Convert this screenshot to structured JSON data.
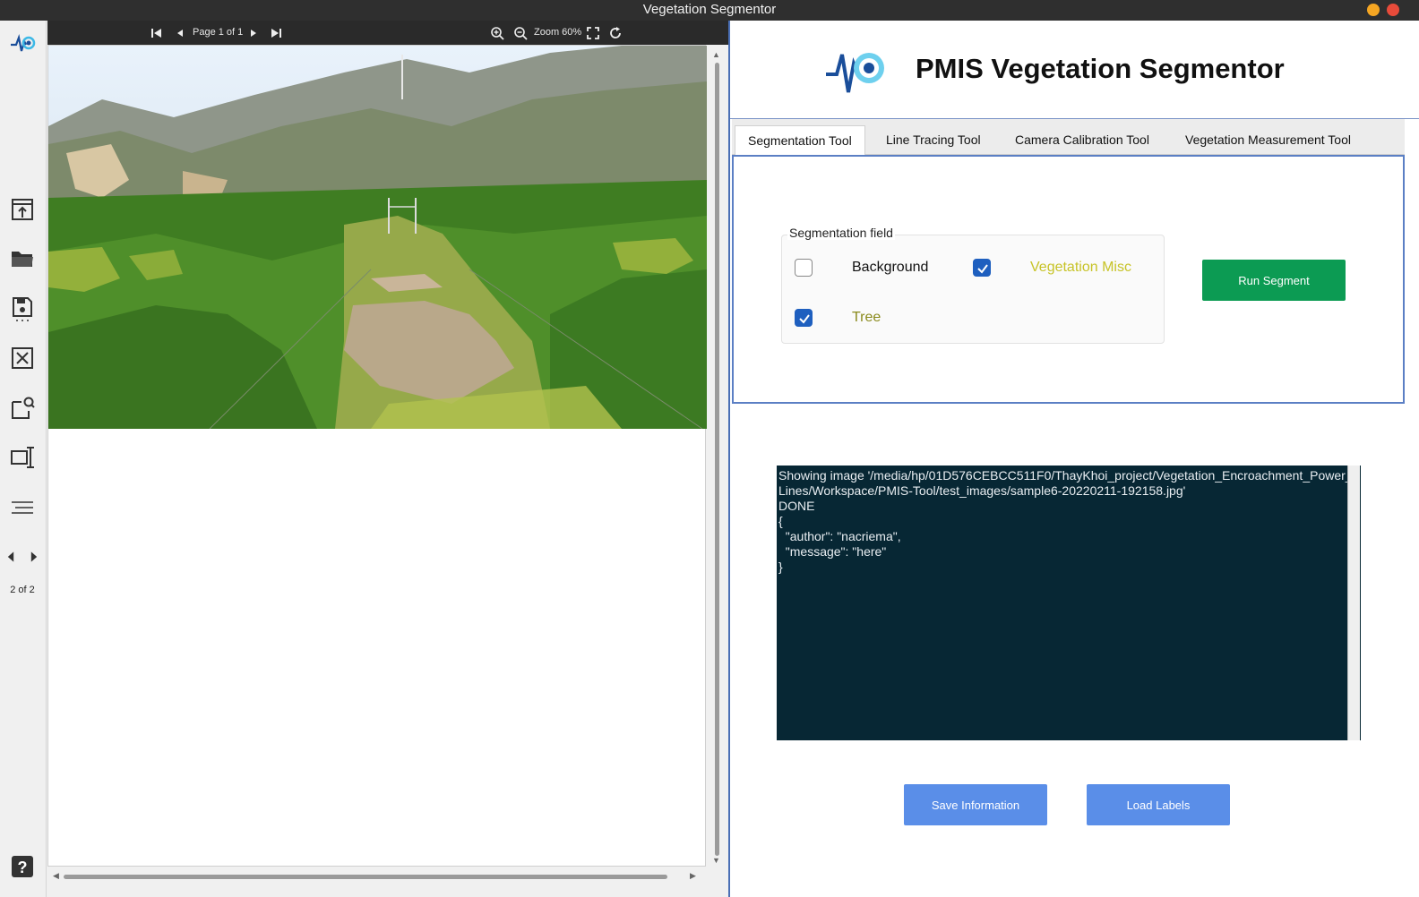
{
  "window": {
    "title": "Vegetation Segmentor"
  },
  "sidebar": {
    "icons": [
      "app-logo-icon",
      "upload-icon",
      "folder-open-icon",
      "save-icon",
      "close-file-icon",
      "search-page-icon",
      "fit-width-icon",
      "menu-lines-icon",
      "prev-icon",
      "next-icon",
      "help-icon"
    ],
    "page_count": "2 of 2"
  },
  "viewer": {
    "page_label": "Page 1 of 1",
    "zoom_label": "Zoom 60%"
  },
  "app": {
    "title": "PMIS Vegetation Segmentor"
  },
  "tabs": [
    {
      "label": "Segmentation Tool",
      "active": true
    },
    {
      "label": "Line Tracing Tool",
      "active": false
    },
    {
      "label": "Camera Calibration Tool",
      "active": false
    },
    {
      "label": "Vegetation Measurement Tool",
      "active": false
    }
  ],
  "segmentation": {
    "field_label": "Segmentation field",
    "options": [
      {
        "label": "Background",
        "checked": false,
        "color": "#111111"
      },
      {
        "label": "Vegetation Misc",
        "checked": true,
        "color": "#c7c327"
      },
      {
        "label": "Tree",
        "checked": true,
        "color": "#8a8a1c"
      }
    ],
    "run_label": "Run Segment"
  },
  "log": {
    "lines": [
      "Showing image '/media/hp/01D576CEBCC511F0/ThayKhoi_project/Vegetation_Encroachment_Power_Lines/Workspace/PMIS-Tool/test_images/sample6-20220211-192158.jpg'",
      "DONE",
      "{",
      "  \"author\": \"nacriema\",",
      "  \"message\": \"here\"",
      "}"
    ]
  },
  "buttons": {
    "save_label": "Save Information",
    "load_label": "Load Labels"
  },
  "colors": {
    "run": "#0c9b53",
    "blue": "#5a8ee8",
    "log_bg": "#072734",
    "accent": "#1e5fbf"
  }
}
